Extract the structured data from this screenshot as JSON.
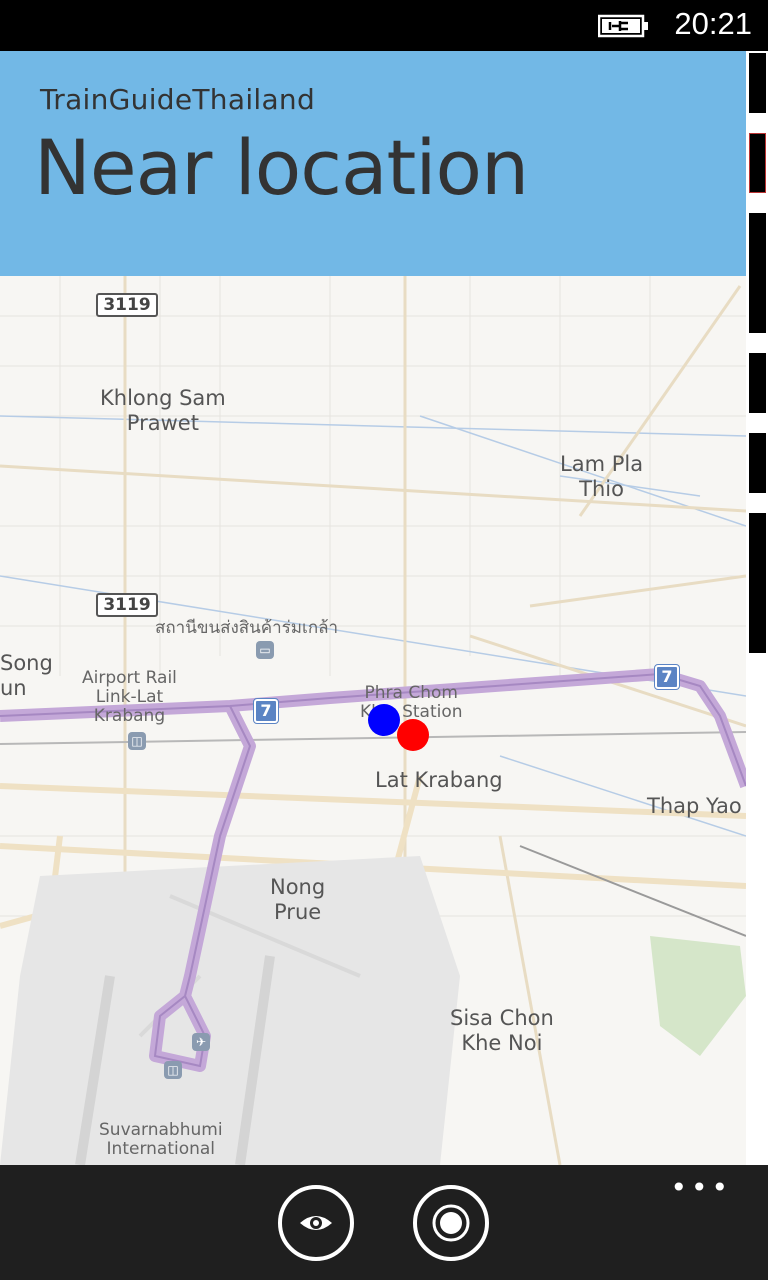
{
  "status_bar": {
    "time": "20:21",
    "battery_icon": "battery-charging-icon"
  },
  "header": {
    "app_title": "TrainGuideThailand",
    "page_title": "Near location",
    "background": "#72b8e6"
  },
  "map": {
    "labels": {
      "khlong_sam_prawet": "Khlong Sam\nPrawet",
      "lam_pla_thio": "Lam Pla\nThio",
      "thai_cargo": "สถานีขนส่งสินค้าร่มเกล้า",
      "song_un": "Song\nun",
      "airport_rail_link": "Airport Rail\nLink-Lat\nKrabang",
      "phra_chom_klao": "Phra Chom\nKlao Station",
      "lat_krabang": "Lat Krabang",
      "thap_yao": "Thap Yao",
      "nong_prue": "Nong\nPrue",
      "sisa_chon_khe_noi": "Sisa Chon\nKhe Noi",
      "suvarnabhumi": "Suvarnabhumi\nInternational"
    },
    "road_shields": {
      "r3119_top": "3119",
      "r3119_mid": "3119"
    },
    "route_shields": {
      "r7_left": "7",
      "r7_right": "7"
    },
    "markers": {
      "blue_color": "#0000ff",
      "red_color": "#ff0000"
    }
  },
  "app_bar": {
    "buttons": [
      "view-icon",
      "locate-icon"
    ],
    "more": "•••"
  }
}
